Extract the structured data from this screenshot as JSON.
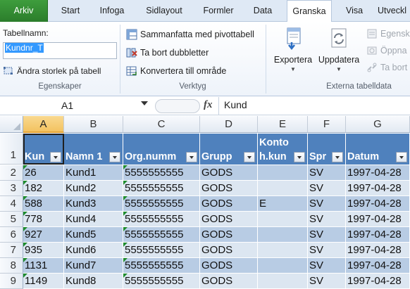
{
  "ribbon_tabs": {
    "file": "Arkiv",
    "start": "Start",
    "infoga": "Infoga",
    "sidlayout": "Sidlayout",
    "formler": "Formler",
    "data": "Data",
    "granska": "Granska",
    "visa": "Visa",
    "utveckl": "Utveckl"
  },
  "properties_group": {
    "table_name_label": "Tabellnamn:",
    "table_name_value": "Kundnr_T",
    "resize_button": "Ändra storlek på tabell",
    "group_label": "Egenskaper"
  },
  "tools_group": {
    "summarize_pivot": "Sammanfatta med pivottabell",
    "remove_duplicates": "Ta bort dubbletter",
    "convert_to_range": "Konvertera till område",
    "group_label": "Verktyg"
  },
  "external_group": {
    "export": "Exportera",
    "refresh": "Uppdatera",
    "properties": "Egensk",
    "open": "Öppna",
    "unlink": "Ta bort",
    "group_label": "Externa tabelldata"
  },
  "formula_bar": {
    "name_box": "A1",
    "fx": "fx",
    "formula": "Kund"
  },
  "grid": {
    "columns": [
      "A",
      "B",
      "C",
      "D",
      "E",
      "F",
      "G"
    ],
    "active_column": "A",
    "header_row_number": "1",
    "headers": [
      "Kun",
      "Namn 1",
      "Org.numm",
      "Grupp",
      "Konto h.kun",
      "Spr",
      "Datum"
    ],
    "rows": [
      {
        "num": "2",
        "cells": [
          "26",
          "Kund1",
          "5555555555",
          "GODS",
          "",
          "SV",
          "1997-04-28"
        ]
      },
      {
        "num": "3",
        "cells": [
          "182",
          "Kund2",
          "5555555555",
          "GODS",
          "",
          "SV",
          "1997-04-28"
        ]
      },
      {
        "num": "4",
        "cells": [
          "588",
          "Kund3",
          "5555555555",
          "GODS",
          "E",
          "SV",
          "1997-04-28"
        ]
      },
      {
        "num": "5",
        "cells": [
          "778",
          "Kund4",
          "5555555555",
          "GODS",
          "",
          "SV",
          "1997-04-28"
        ]
      },
      {
        "num": "6",
        "cells": [
          "927",
          "Kund5",
          "5555555555",
          "GODS",
          "",
          "SV",
          "1997-04-28"
        ]
      },
      {
        "num": "7",
        "cells": [
          "935",
          "Kund6",
          "5555555555",
          "GODS",
          "",
          "SV",
          "1997-04-28"
        ]
      },
      {
        "num": "8",
        "cells": [
          "1131",
          "Kund7",
          "5555555555",
          "GODS",
          "",
          "SV",
          "1997-04-28"
        ]
      },
      {
        "num": "9",
        "cells": [
          "1149",
          "Kund8",
          "5555555555",
          "GODS",
          "",
          "SV",
          "1997-04-28"
        ]
      }
    ]
  },
  "colors": {
    "file_tab": "#2b7d2b",
    "table_header": "#4f81bd",
    "band_light": "#dce6f1",
    "band_dark": "#b8cce4",
    "active_column_header": "#f3c261",
    "error_indicator": "#1e8c2e"
  }
}
